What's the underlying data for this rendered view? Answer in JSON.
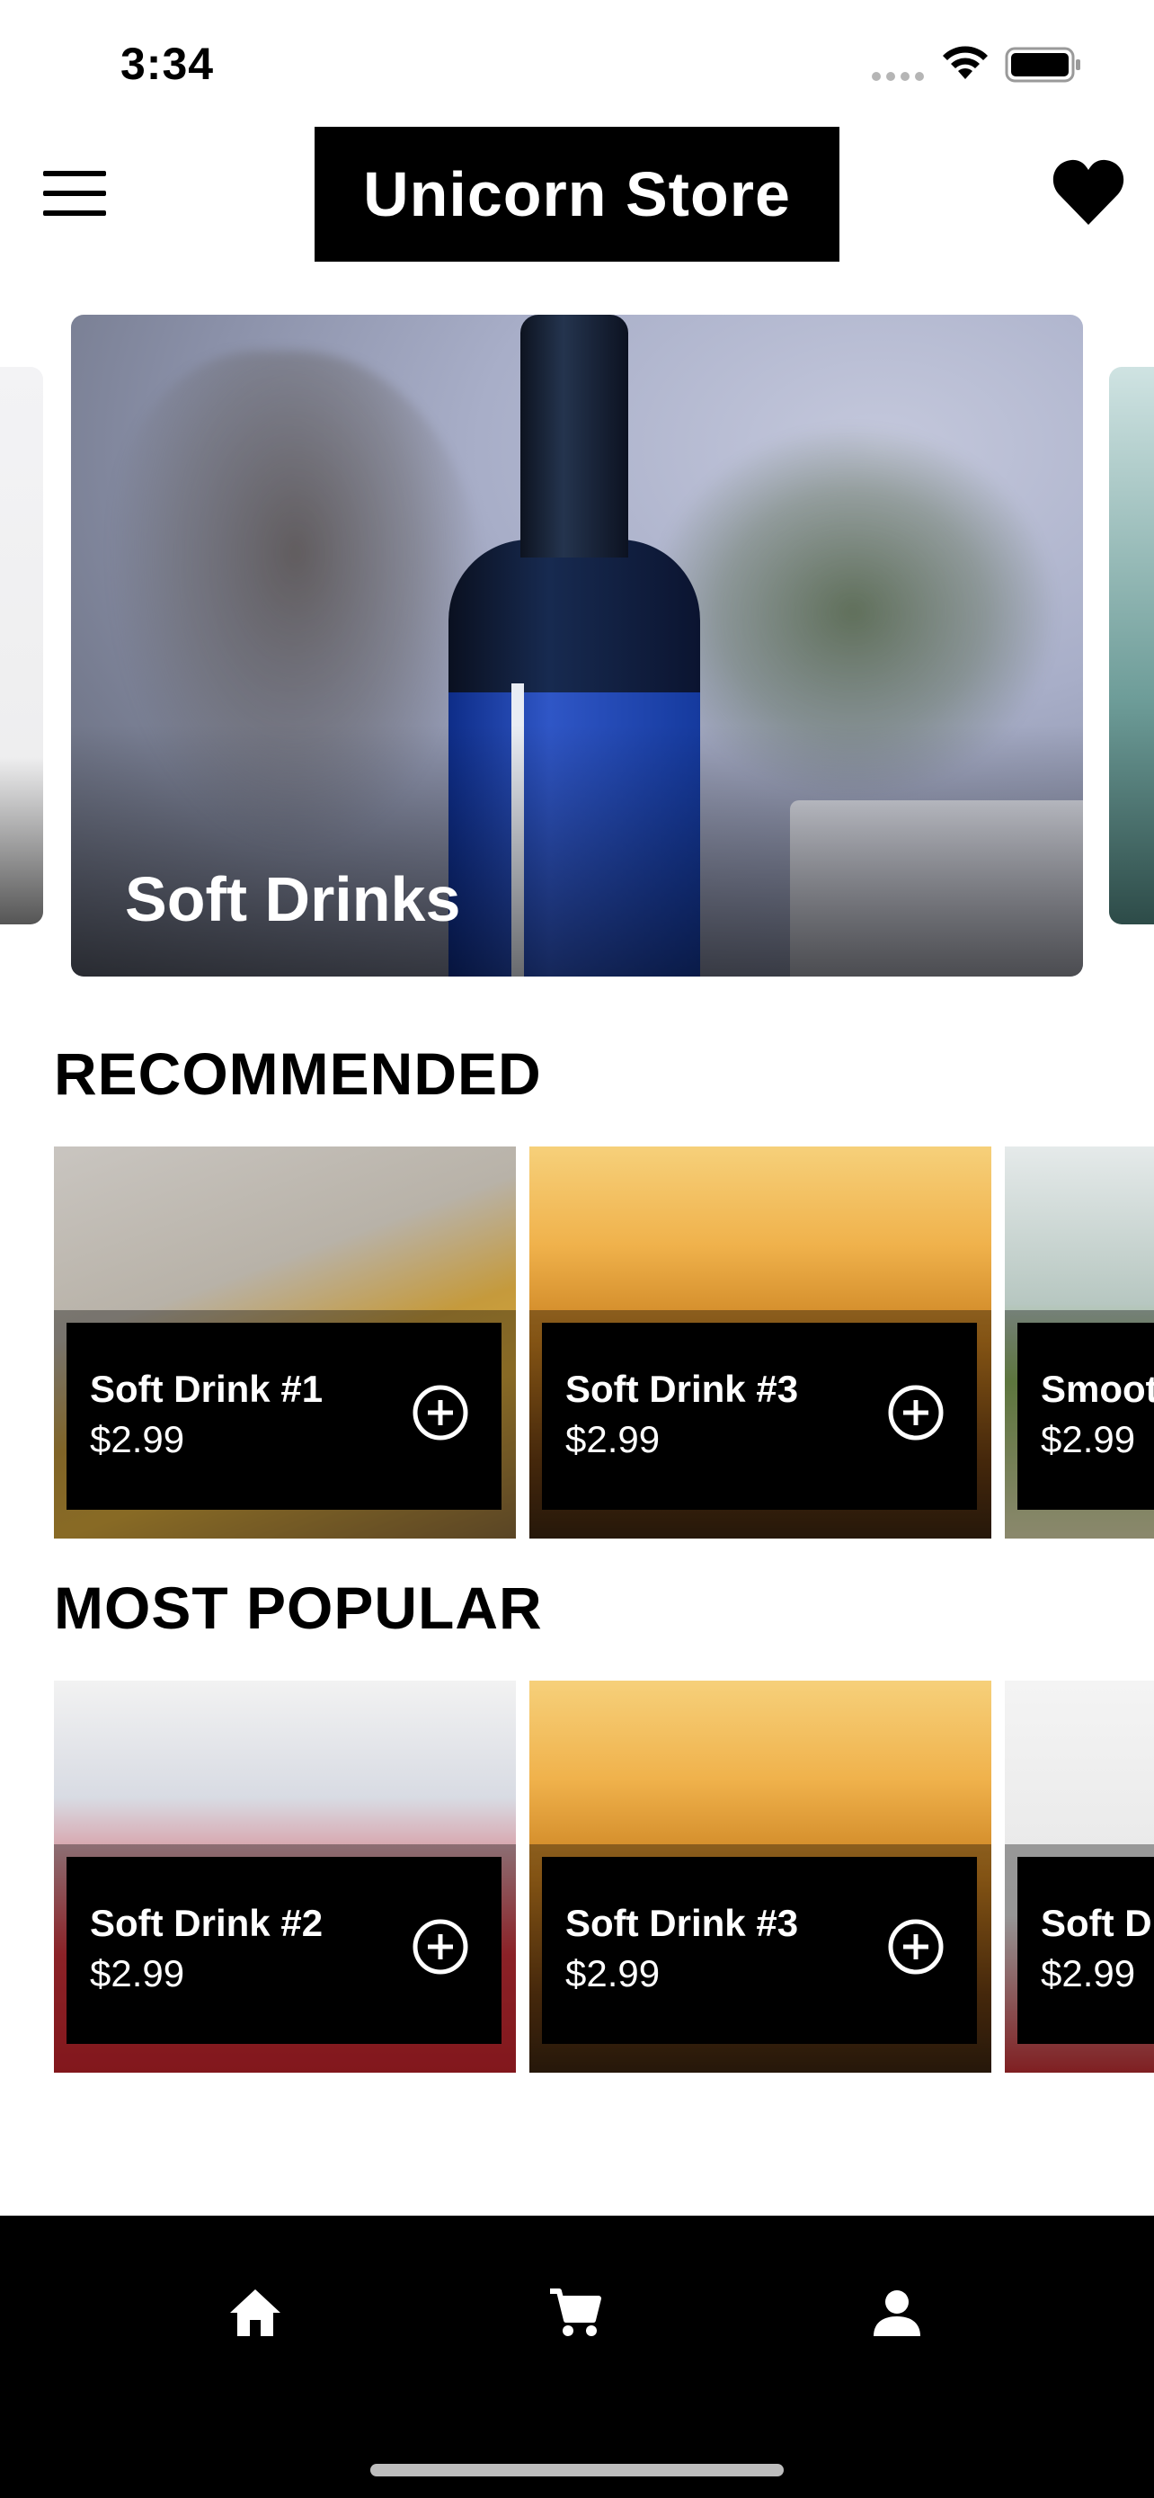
{
  "status_bar": {
    "time": "3:34"
  },
  "header": {
    "title": "Unicorn Store"
  },
  "carousel": {
    "featured_title": "Soft Drinks"
  },
  "sections": {
    "recommended": {
      "title": "RECOMMENDED",
      "items": [
        {
          "name": "Soft Drink #1",
          "price": "$2.99"
        },
        {
          "name": "Soft Drink #3",
          "price": "$2.99"
        },
        {
          "name": "Smoot",
          "price": "$2.99"
        }
      ]
    },
    "most_popular": {
      "title": "MOST POPULAR",
      "items": [
        {
          "name": "Soft Drink #2",
          "price": "$2.99"
        },
        {
          "name": "Soft Drink #3",
          "price": "$2.99"
        },
        {
          "name": "Soft D",
          "price": "$2.99"
        }
      ]
    }
  },
  "icons": {
    "menu": "menu-icon",
    "favorites": "heart-icon",
    "add": "add-circle-icon",
    "nav": [
      "home-icon",
      "cart-icon",
      "profile-icon"
    ]
  },
  "colors": {
    "accent": "#000000",
    "background": "#ffffff",
    "nav_icon": "#ffffff"
  }
}
